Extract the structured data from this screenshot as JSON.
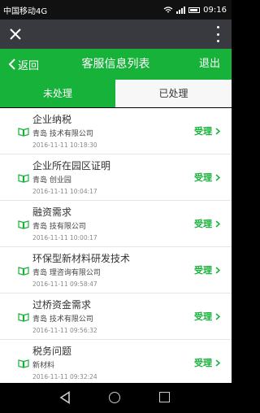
{
  "status": {
    "carrier": "中国移动4G",
    "time": "09:16"
  },
  "titlebar": {
    "close_icon": "close-icon",
    "more_icon": "more-vertical-icon"
  },
  "navbar": {
    "back_label": "返回",
    "title": "客服信息列表",
    "exit_label": "退出"
  },
  "tabs": [
    {
      "label": "未处理",
      "active": true
    },
    {
      "label": "已处理",
      "active": false
    }
  ],
  "items": [
    {
      "title": "企业纳税",
      "company": "青岛  技术有限公司",
      "time": "2016-11-11 10:18:30",
      "action": "受理"
    },
    {
      "title": "企业所在园区证明",
      "company": "青岛 创业园",
      "time": "2016-11-11 10:04:17",
      "action": "受理"
    },
    {
      "title": "融资需求",
      "company": "青岛  技有限公司",
      "time": "2016-11-11 10:00:17",
      "action": "受理"
    },
    {
      "title": "环保型新材料研发技术",
      "company": "青岛  理咨询有限公司",
      "time": "2016-11-11 09:58:47",
      "action": "受理"
    },
    {
      "title": "过桥资金需求",
      "company": "青岛  技术有限公司",
      "time": "2016-11-11 09:56:32",
      "action": "受理"
    },
    {
      "title": "税务问题",
      "company": "新材料",
      "time": "2016-11-11 09:32:24",
      "action": "受理"
    }
  ],
  "colors": {
    "accent": "#17b23a",
    "titlebar": "#393a3f"
  }
}
